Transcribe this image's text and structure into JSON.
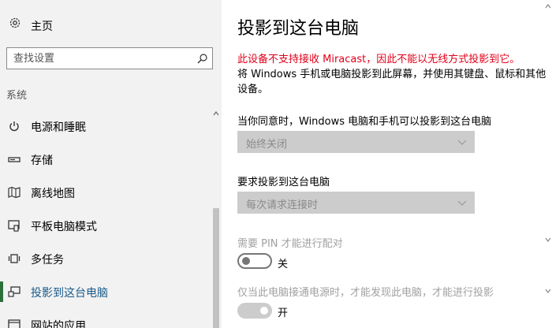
{
  "sidebar": {
    "home_label": "主页",
    "search_placeholder": "查找设置",
    "section": "系统",
    "items": [
      {
        "label": "电源和睡眠",
        "icon": "power-icon"
      },
      {
        "label": "存储",
        "icon": "storage-icon"
      },
      {
        "label": "离线地图",
        "icon": "map-icon"
      },
      {
        "label": "平板电脑模式",
        "icon": "tablet-mode-icon"
      },
      {
        "label": "多任务",
        "icon": "multitasking-icon"
      },
      {
        "label": "投影到这台电脑",
        "icon": "project-icon",
        "active": true
      },
      {
        "label": "网站的应用",
        "icon": "apps-for-websites-icon"
      }
    ]
  },
  "main": {
    "title": "投影到这台电脑",
    "warning": "此设备不支持接收 Miracast，因此不能以无线方式投影到它。",
    "description": "将 Windows 手机或电脑投影到此屏幕，并使用其键盘、鼠标和其他设备。",
    "setting1_label": "当你同意时，Windows 电脑和手机可以投影到这台电脑",
    "setting1_value": "始终关闭",
    "setting2_label": "要求投影到这台电脑",
    "setting2_value": "每次请求连接时",
    "pin_label": "需要 PIN 才能进行配对",
    "pin_state": "关",
    "power_label": "仅当此电脑接通电源时，才能发现此电脑，才能进行投影",
    "power_state": "开"
  },
  "colors": {
    "warning": "#e0001a",
    "active_indicator": "#2b6f3a",
    "sidebar_bg": "#f2f2f2",
    "disabled_control": "#cccccc"
  }
}
